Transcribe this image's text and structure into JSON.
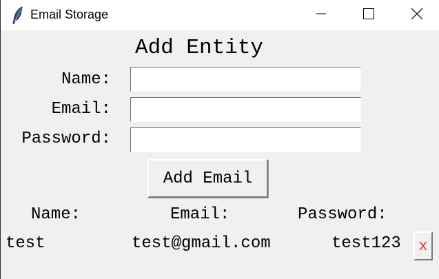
{
  "window": {
    "title": "Email Storage",
    "icon": "feather-icon",
    "controls": [
      "minimize-icon",
      "maximize-icon",
      "close-icon"
    ]
  },
  "form": {
    "heading": "Add Entity",
    "name_label": "Name:",
    "email_label": "Email:",
    "password_label": "Password:",
    "name_value": "",
    "email_value": "",
    "password_value": "",
    "submit_label": "Add Email"
  },
  "table": {
    "headers": [
      "Name:",
      "Email:",
      "Password:"
    ],
    "rows": [
      {
        "name": "test",
        "email": "test@gmail.com",
        "password": "test123",
        "delete_label": "x"
      }
    ]
  },
  "colors": {
    "delete_text": "#e53935",
    "background": "#f0f0f0"
  }
}
